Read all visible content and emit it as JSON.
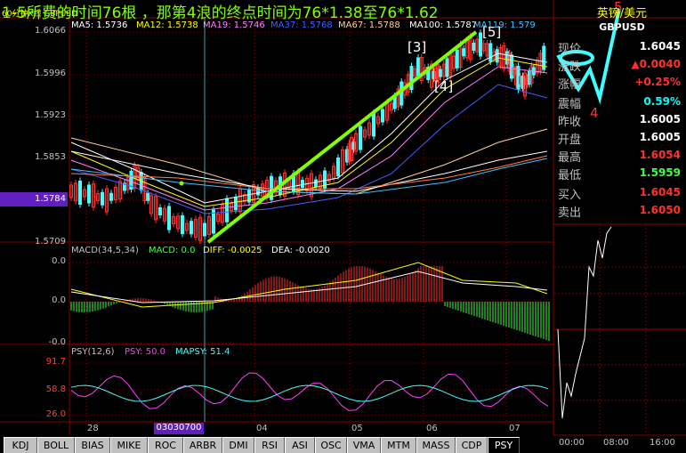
{
  "header": {
    "symbol_label": "60分钟K线 GBPUSD",
    "annotation_title": "1-5所费的时间76根 ，那第4浪的终点时间为76*1.38至76*1.62",
    "ma_labels": [
      "MA5: 1.5736",
      "MA12: 1.5738",
      "MA19: 1.5746",
      "MA37: 1.5768",
      "MA67: 1.5788",
      "MA100: 1.5787",
      "MA119: 1.579"
    ]
  },
  "price_axis": [
    "1.6066",
    "1.5996",
    "1.5923",
    "1.5853",
    "1.5784",
    "1.5709"
  ],
  "macd": {
    "title": "MACD(34,5,34)",
    "macd_label": "MACD: 0.0",
    "diff_label": "DIFF: -0.0025",
    "dea_label": "DEA: -0.0020",
    "axis": [
      "0.0",
      "0.0",
      "-0.0"
    ]
  },
  "psy": {
    "title": "PSY(12,6)",
    "psy_label": "PSY: 50.0",
    "mapsy_label": "MAPSY: 51.4",
    "axis": [
      "91.7",
      "58.8",
      "26.0"
    ]
  },
  "x_axis": {
    "labels": [
      "28",
      "04",
      "05",
      "06",
      "07"
    ],
    "cursor_date": "03030700"
  },
  "wave_labels": [
    "[3]",
    "[4]",
    "[5]",
    "4",
    "5"
  ],
  "quote": {
    "title": "英镑/美元",
    "code": "GBPUSD",
    "rows": [
      {
        "label": "现价",
        "value": "1.6045",
        "color": "#ffffff"
      },
      {
        "label": "涨跌",
        "value": "▲0.0040",
        "color": "#ff3030"
      },
      {
        "label": "涨幅",
        "value": "+0.25%",
        "color": "#ff3030"
      },
      {
        "label": "震幅",
        "value": "0.59%",
        "color": "#00ffff"
      },
      {
        "label": "昨收",
        "value": "1.6005",
        "color": "#ffffff"
      },
      {
        "label": "开盘",
        "value": "1.6005",
        "color": "#ffffff"
      },
      {
        "label": "最高",
        "value": "1.6054",
        "color": "#ff3030"
      },
      {
        "label": "最低",
        "value": "1.5959",
        "color": "#40ff40"
      },
      {
        "label": "买入",
        "value": "1.6045",
        "color": "#ff3030"
      },
      {
        "label": "卖出",
        "value": "1.6050",
        "color": "#ff3030"
      }
    ]
  },
  "mini_chart": {
    "time_labels": [
      "00:00",
      "08:00",
      "16:00"
    ]
  },
  "tabs": [
    "KDJ",
    "BOLL",
    "BIAS",
    "MIKE",
    "ROC",
    "ARBR",
    "DMI",
    "RSI",
    "ASI",
    "OSC",
    "VMA",
    "MTM",
    "MASS",
    "CDP",
    "PSY"
  ],
  "active_tab": "PSY",
  "colors": {
    "up": "#ff3030",
    "down": "#40ffff",
    "accent_line": "#7fff00",
    "axis_grid": "#800000"
  }
}
